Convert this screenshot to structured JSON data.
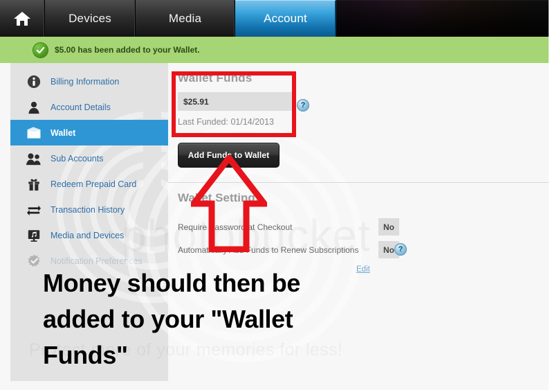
{
  "nav": {
    "home_icon": "home-icon",
    "tabs": [
      {
        "label": "Devices",
        "selected": false
      },
      {
        "label": "Media",
        "selected": false
      },
      {
        "label": "Account",
        "selected": true
      }
    ]
  },
  "banner": {
    "icon": "check-circle-icon",
    "message": "$5.00 has been added to your Wallet.",
    "background": "#a6d575"
  },
  "sidebar": {
    "items": [
      {
        "label": "Billing Information",
        "icon": "info-icon",
        "selected": false,
        "dim": false
      },
      {
        "label": "Account Details",
        "icon": "user-icon",
        "selected": false,
        "dim": false
      },
      {
        "label": "Wallet",
        "icon": "wallet-icon",
        "selected": true,
        "dim": false
      },
      {
        "label": "Sub Accounts",
        "icon": "users-icon",
        "selected": false,
        "dim": false
      },
      {
        "label": "Redeem Prepaid Card",
        "icon": "gift-icon",
        "selected": false,
        "dim": false
      },
      {
        "label": "Transaction History",
        "icon": "transfer-arrows-icon",
        "selected": false,
        "dim": false
      },
      {
        "label": "Media and Devices",
        "icon": "monitor-music-icon",
        "selected": false,
        "dim": false
      },
      {
        "label": "Notification Preferences",
        "icon": "gear-check-icon",
        "selected": false,
        "dim": true
      }
    ],
    "selected_color": "#2e96d4",
    "link_color": "#2f6fa8"
  },
  "wallet_funds": {
    "title": "Wallet Funds",
    "balance": "$25.91",
    "last_funded": "Last Funded: 01/14/2013",
    "help_icon": "help-icon",
    "help_glyph": "?"
  },
  "actions": {
    "add_funds_label": "Add Funds to Wallet"
  },
  "wallet_settings": {
    "title": "Wallet Settings",
    "rows": [
      {
        "label": "Require Password at Checkout",
        "value": "No",
        "has_help": false
      },
      {
        "label": "Automatically Add Funds to Renew Subscriptions",
        "value": "No",
        "has_help": true
      }
    ],
    "help_glyph": "?",
    "edit_label": "Edit"
  },
  "watermark": {
    "main": "photobucket",
    "sub": "Protect more of your memories for less!"
  },
  "annotations": {
    "color": "#e8141c",
    "box_target": "wallet-funds-panel",
    "arrow_target": "add-funds-to-wallet-button",
    "caption": "Money should then be added to your \"Wallet Funds\""
  }
}
